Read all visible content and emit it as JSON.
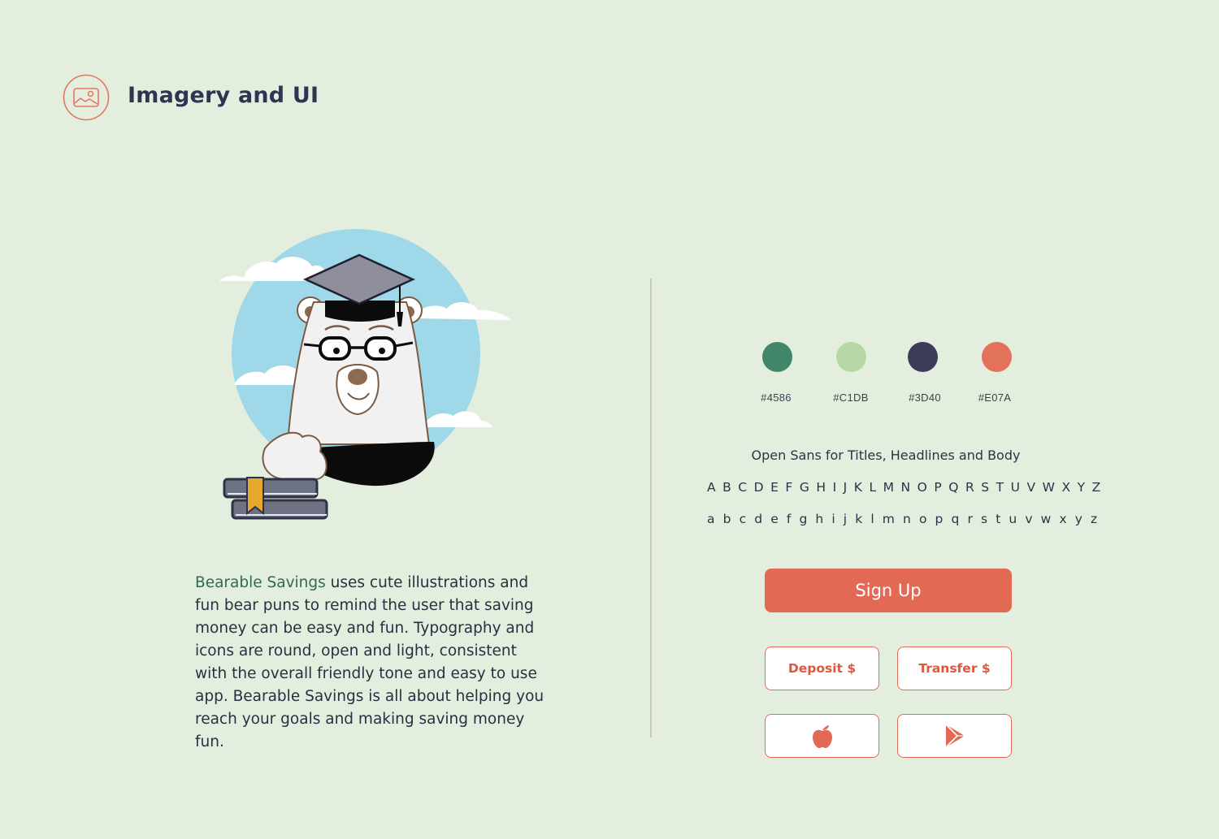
{
  "header": {
    "title": "Imagery and UI",
    "icon": "image-icon"
  },
  "illustration": {
    "icon": "graduate-bear-illustration"
  },
  "description": {
    "brand": "Bearable Savings",
    "text": " uses cute illustrations and fun bear puns to remind the user that saving money can be easy and fun.  Typography and icons are round, open and light, consistent with the overall friendly tone and easy to use app.  Bearable Savings is all about helping you reach your goals and making saving money fun."
  },
  "palette": [
    {
      "label": "#4586",
      "color": "#428669"
    },
    {
      "label": "#C1DB",
      "color": "#b8d7a6"
    },
    {
      "label": "#3D40",
      "color": "#3a3c5a"
    },
    {
      "label": "#E07A",
      "color": "#e2735a"
    }
  ],
  "typography": {
    "title": "Open Sans for Titles,  Headlines and Body",
    "uppercase": "A B C D E F G H I J K L M N O P Q R S T U V W X Y Z",
    "lowercase": "a b c d e f g h i j k l m n o p q r s t u v w x y z"
  },
  "buttons": {
    "sign_up": "Sign Up",
    "deposit": "Deposit $",
    "transfer": "Transfer $",
    "apple_icon": "apple-icon",
    "play_icon": "play-store-icon"
  },
  "colors": {
    "background": "#e4eede",
    "accent": "#e26a55",
    "brand_text": "#2f6b4f",
    "heading": "#2f3550"
  }
}
